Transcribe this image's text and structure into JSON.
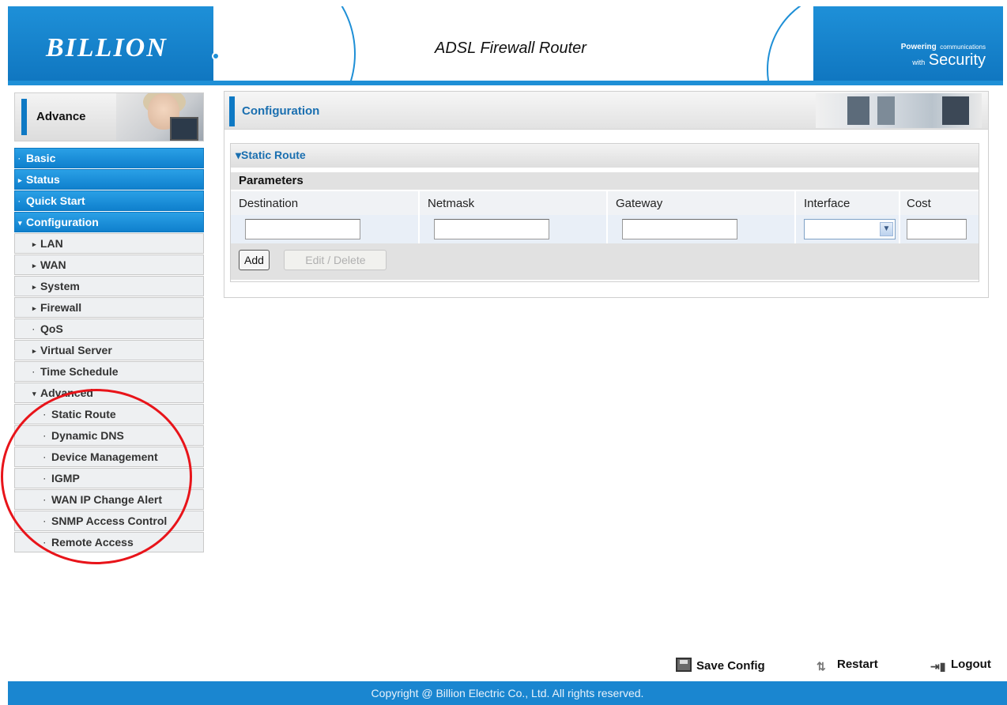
{
  "header": {
    "logo": "BILLION",
    "title": "ADSL Firewall Router",
    "tagline_line1": "Powering",
    "tagline_line1b": "communications",
    "tagline_line2a": "with",
    "tagline_line2b": "Security"
  },
  "sidebar": {
    "head_label": "Advance",
    "items": [
      {
        "label": "Basic",
        "marker": "·"
      },
      {
        "label": "Status",
        "marker": "▸"
      },
      {
        "label": "Quick Start",
        "marker": "·"
      },
      {
        "label": "Configuration",
        "marker": "▾"
      },
      {
        "label": "LAN",
        "marker": "▸"
      },
      {
        "label": "WAN",
        "marker": "▸"
      },
      {
        "label": "System",
        "marker": "▸"
      },
      {
        "label": "Firewall",
        "marker": "▸"
      },
      {
        "label": "QoS",
        "marker": "·"
      },
      {
        "label": "Virtual Server",
        "marker": "▸"
      },
      {
        "label": "Time Schedule",
        "marker": "·"
      },
      {
        "label": "Advanced",
        "marker": "▾"
      },
      {
        "label": "Static Route",
        "marker": "·"
      },
      {
        "label": "Dynamic DNS",
        "marker": "·"
      },
      {
        "label": "Device Management",
        "marker": "·"
      },
      {
        "label": "IGMP",
        "marker": "·"
      },
      {
        "label": "WAN IP Change Alert",
        "marker": "·"
      },
      {
        "label": "SNMP Access Control",
        "marker": "·"
      },
      {
        "label": "Remote Access",
        "marker": "·"
      }
    ]
  },
  "main": {
    "title": "Configuration",
    "section_title": "Static Route",
    "section_marker": "▾",
    "params_label": "Parameters",
    "columns": [
      "Destination",
      "Netmask",
      "Gateway",
      "Interface",
      "Cost"
    ],
    "destination_value": "",
    "netmask_value": "",
    "gateway_value": "",
    "interface_value": "",
    "cost_value": "",
    "add_label": "Add",
    "edit_delete_label": "Edit / Delete"
  },
  "actions": {
    "save": "Save Config",
    "restart": "Restart",
    "logout": "Logout"
  },
  "footer": {
    "copyright": "Copyright @ Billion Electric Co., Ltd. All rights reserved."
  },
  "colors": {
    "brand_blue": "#1e8fd6",
    "menu_blue": "#0f80cd",
    "highlight_circle": "#e8141a"
  },
  "icons": {
    "select_arrow": "chevron-down-icon",
    "save": "floppy-disk-icon",
    "restart": "restart-arrows-icon",
    "logout": "door-exit-icon"
  }
}
